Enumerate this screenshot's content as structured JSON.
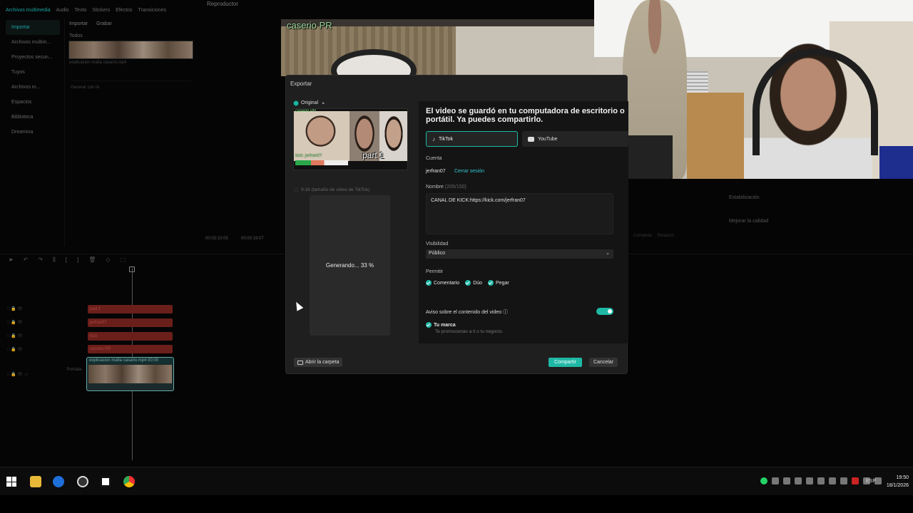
{
  "editor": {
    "top_tabs": [
      "Archivos multimedia",
      "Audio",
      "Texto",
      "Stickers",
      "Efectos",
      "Transiciones"
    ],
    "player_title": "Reproductor",
    "left_nav": [
      "Importar",
      "Archivos multim...",
      "Proyectos secun...",
      "Tuyos",
      "Archivos m...",
      "Espacios",
      "Biblioteca",
      "Dreamina"
    ],
    "media_toolbar": [
      "Importar",
      "Grabar"
    ],
    "media_all": "Todos",
    "media_thumb_caption": "explicacion mafia casario.mp4",
    "generate_ia": "Generar con IA",
    "timecode_current": "00:03:10:05",
    "timecode_total": "00:00:19:07",
    "track_clips": [
      "part 1",
      "jerfran07",
      "kick",
      "caserio PR"
    ],
    "main_clip_label": "explicacion mafia casario.mp4   00:00",
    "portada": "Portada",
    "right_panel": [
      "Estabilización",
      "Mejorar la calidad"
    ],
    "player_controls": [
      "Completa",
      "Relación"
    ],
    "preview_label": "caserio PR"
  },
  "dialog": {
    "title": "Exportar",
    "original_label": "Original",
    "thumb_label": "caserio PR",
    "thumb_part": "part 1",
    "thumb_kick": "kick: jerfran07",
    "tiktok_option": "9:16 (tamaño de video de TikTok)",
    "generating": "Generando... 33 %",
    "saved_msg": "El video se guardó en tu computadora de escritorio o portátil. Ya puedes compartirlo.",
    "tabs": {
      "tiktok": "TikTok",
      "youtube": "YouTube"
    },
    "account_label": "Cuenta",
    "account_name": "jerfran07",
    "logout": "Cerrar sesión",
    "name_label": "Nombre",
    "name_count": "(205/150)",
    "name_value": "CANAL DE KICK:https://kick.com/jerfran07",
    "visibility_label": "Visibilidad",
    "visibility_value": "Público",
    "permit_label": "Permitir",
    "permits": [
      "Comentario",
      "Dúo",
      "Pegar"
    ],
    "aviso_label": "Aviso sobre el contenido del video ⓘ",
    "brand_label": "Tu marca",
    "brand_desc": "Te promocionas a ti o tu negocio.",
    "btn_folder": "Abrir la carpeta",
    "btn_share": "Compartir",
    "btn_cancel": "Cancelar"
  },
  "taskbar": {
    "lang": "ESP",
    "time": "19:50",
    "date": "18/1/2026"
  },
  "colors": {
    "accent": "#1fb8a6",
    "link": "#35c7d6",
    "dialog_bg": "#1f1f1f"
  }
}
